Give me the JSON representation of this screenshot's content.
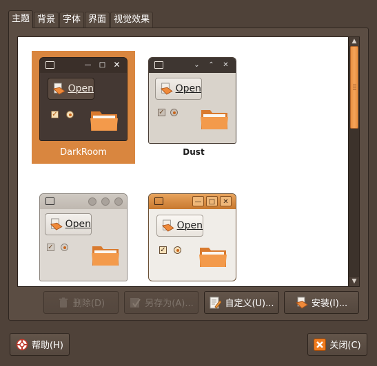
{
  "tabs": [
    {
      "label": "主题",
      "active": true
    },
    {
      "label": "背景",
      "active": false
    },
    {
      "label": "字体",
      "active": false
    },
    {
      "label": "界面",
      "active": false
    },
    {
      "label": "视觉效果",
      "active": false
    }
  ],
  "themes": [
    {
      "name": "DarkRoom",
      "selected": true,
      "open_label": "Open"
    },
    {
      "name": "Dust",
      "selected": false,
      "open_label": "Open"
    },
    {
      "name": "",
      "selected": false,
      "open_label": "Open"
    },
    {
      "name": "",
      "selected": false,
      "open_label": "Open"
    }
  ],
  "actions": {
    "delete_label": "删除(D)",
    "save_as_label": "另存为(A)...",
    "customize_label": "自定义(U)...",
    "install_label": "安装(I)..."
  },
  "footer": {
    "help_label": "帮助(H)",
    "close_label": "关闭(C)"
  },
  "colors": {
    "window_bg": "#4f4239",
    "accent": "#d9863f",
    "selection": "#d9863f"
  }
}
